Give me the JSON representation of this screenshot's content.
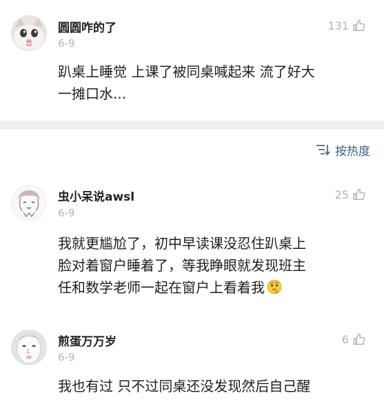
{
  "comments": [
    {
      "username": "圆圆咋的了",
      "date": "6-9",
      "likes": "131",
      "text": "趴桌上睡觉 上课了被同桌喊起来 流了好大\n一摊口水..."
    },
    {
      "username": "虫小呆说awsl",
      "date": "6-9",
      "likes": "25",
      "text": "我就更尴尬了，初中早读课没忍住趴桌上\n脸对着窗户睡着了，等我睁眼就发现班主\n任和数学老师一起在窗户上看着我",
      "trailing_emoji": "thinking-face-emoji"
    },
    {
      "username": "煎蛋万万岁",
      "date": "6-9",
      "likes": "6",
      "text": "我也有过 只不过同桌还没发现然后自己醒"
    }
  ],
  "sort": {
    "label": "按热度",
    "icon": "sort-icon"
  },
  "icons": {
    "like": "thumbs-up-icon"
  },
  "colors": {
    "meta_gray": "#b4b4b4",
    "sort_blue": "#3f5f8a",
    "divider": "#f1f1f3"
  }
}
